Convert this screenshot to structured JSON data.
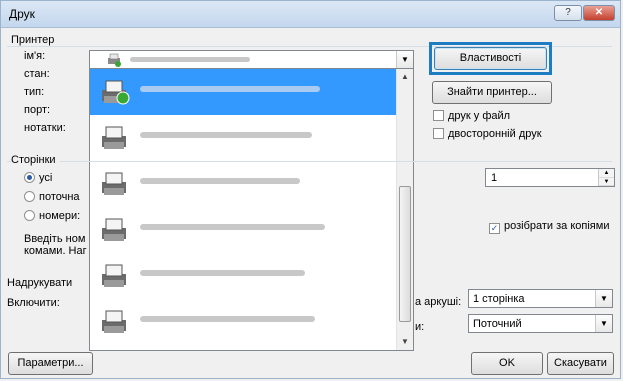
{
  "window": {
    "title": "Друк",
    "help_label": "?",
    "close_label": "✕"
  },
  "printer": {
    "group_title": "Принтер",
    "name_label": "ім'я:",
    "status_label": "стан:",
    "type_label": "тип:",
    "port_label": "порт:",
    "notes_label": "нотатки:",
    "properties_button": "Властивості",
    "find_printer_button": "Знайти принтер...",
    "print_to_file_label": "друк у файл",
    "duplex_label": "двосторонній друк",
    "dropdown_items": [
      {
        "selected": true
      },
      {
        "selected": false
      },
      {
        "selected": false
      },
      {
        "selected": false
      },
      {
        "selected": false
      },
      {
        "selected": false
      }
    ]
  },
  "pages": {
    "group_title": "Сторінки",
    "all_label": "усі",
    "current_label": "поточна",
    "numbers_label": "номери:",
    "hint_line1": "Введіть ном",
    "hint_line2": "комами. Наг",
    "copies_value": "1",
    "collate_label": "розібрати за копіями"
  },
  "print_what_label": "Надрукувати",
  "include_label": "Включити:",
  "per_sheet_label": "а аркуші:",
  "per_sheet_value": "1 сторінка",
  "scale_label": "и:",
  "scale_value": "Поточний",
  "footer": {
    "options_button": "Параметри...",
    "ok_button": "OK",
    "cancel_button": "Скасувати"
  },
  "colors": {
    "selection": "#3399ff",
    "highlight_box": "#1e7cc3"
  }
}
